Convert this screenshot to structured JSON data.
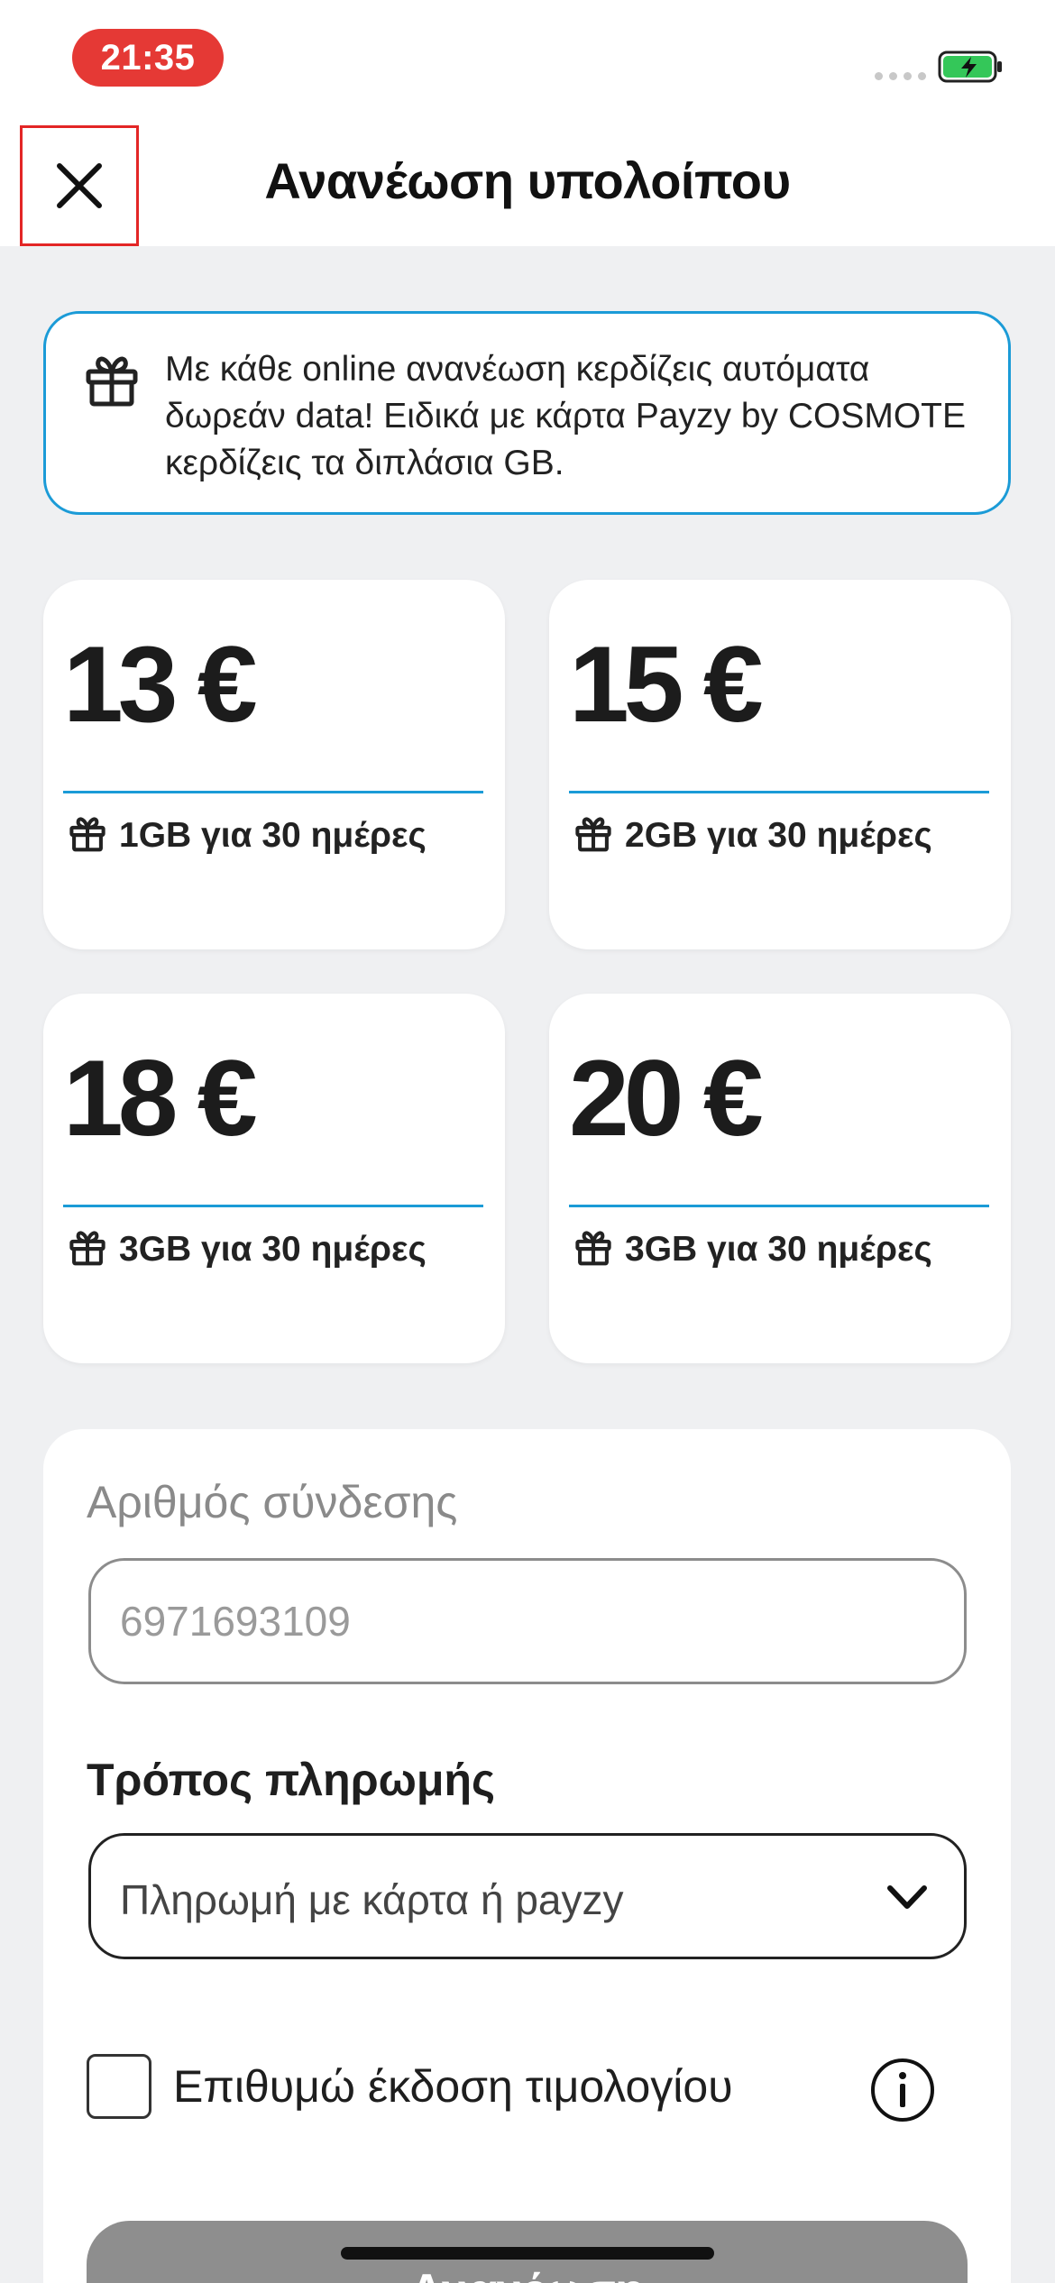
{
  "status_bar": {
    "time": "21:35"
  },
  "header": {
    "title": "Ανανέωση υπολοίπου"
  },
  "promo": {
    "text": "Με κάθε online ανανέωση κερδίζεις αυτόματα δωρεάν data! Ειδικά με κάρτα Payzy by COSMOTE κερδίζεις τα διπλάσια GB."
  },
  "cards": [
    {
      "price": "13 €",
      "bonus": "1GB για 30 ημέρες"
    },
    {
      "price": "15 €",
      "bonus": "2GB για 30 ημέρες"
    },
    {
      "price": "18 €",
      "bonus": "3GB για 30 ημέρες"
    },
    {
      "price": "20 €",
      "bonus": "3GB για 30 ημέρες"
    }
  ],
  "form": {
    "number_label": "Αριθμός σύνδεσης",
    "number_value": "6971693109",
    "payment_label": "Τρόπος πληρωμής",
    "payment_value": "Πληρωμή με κάρτα ή payzy",
    "invoice_label": "Επιθυμώ έκδοση τιμολογίου",
    "submit_label": "Ανανέωση"
  },
  "colors": {
    "accent": "#1b9bd7",
    "time_pill": "#e53935",
    "battery": "#34c759",
    "close_highlight": "#e32626"
  }
}
